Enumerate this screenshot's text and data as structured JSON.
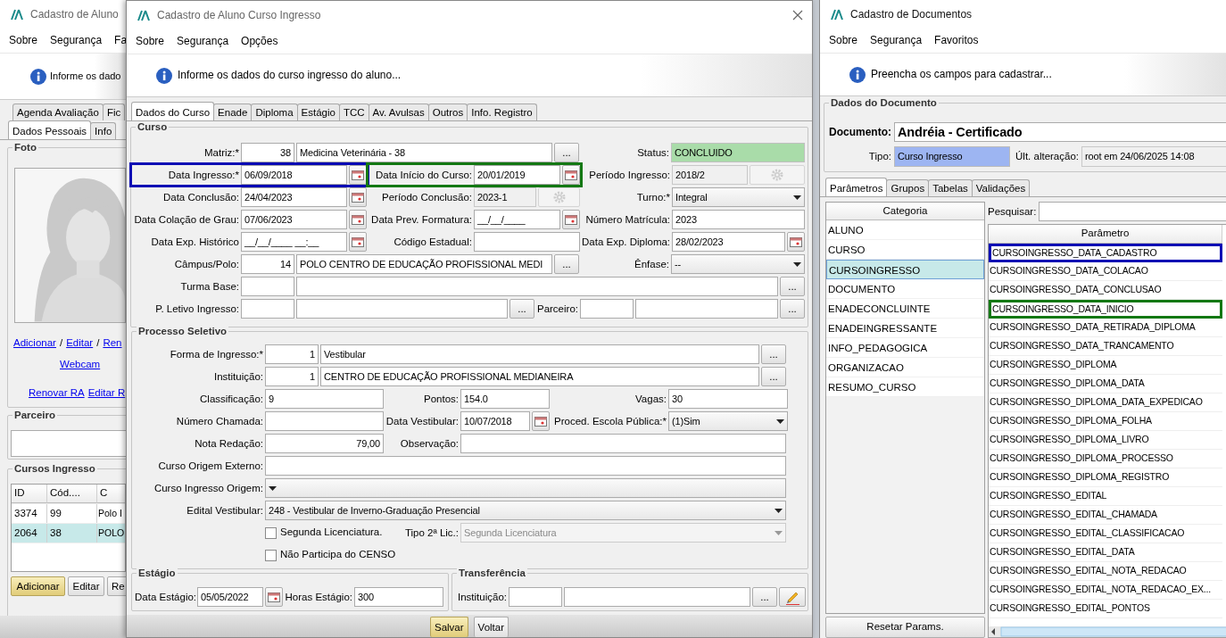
{
  "aluno_window": {
    "title": "Cadastro de Aluno",
    "menu": [
      "Sobre",
      "Segurança",
      "Fa"
    ],
    "info": "Informe os dado",
    "tab_rows": [
      {
        "tabs": [
          {
            "label": "Agenda Avaliação",
            "selected": false
          },
          {
            "label": "Fic",
            "selected": false
          }
        ]
      },
      {
        "tabs": [
          {
            "label": "Dados Pessoais",
            "selected": true
          },
          {
            "label": "Info",
            "selected": false
          }
        ]
      }
    ],
    "foto": {
      "title": "Foto",
      "link_rows": [
        {
          "items": [
            {
              "kind": "link",
              "text": "Adicionar"
            },
            {
              "kind": "sep",
              "text": "/"
            },
            {
              "kind": "link",
              "text": "Editar"
            },
            {
              "kind": "sep",
              "text": "/"
            },
            {
              "kind": "link",
              "text": "Ren"
            }
          ]
        },
        {
          "items": [
            {
              "kind": "link",
              "text": "Webcam"
            }
          ]
        },
        {
          "items": [
            {
              "kind": "link",
              "text": "Renovar RA"
            },
            {
              "kind": "link",
              "text": "Editar R"
            }
          ]
        }
      ]
    },
    "parceiro": {
      "title": "Parceiro"
    },
    "cursos": {
      "title": "Cursos Ingresso",
      "columns": [
        "ID",
        "Cód....",
        "C"
      ],
      "rows": [
        {
          "cells": [
            "3374",
            "99",
            "Polo I"
          ],
          "selected": false
        },
        {
          "cells": [
            "2064",
            "38",
            "POLO"
          ],
          "selected": true
        }
      ],
      "buttons": [
        {
          "label": "Adicionar",
          "default": true
        },
        {
          "label": "Editar",
          "default": false
        },
        {
          "label": "Re",
          "default": false
        }
      ]
    }
  },
  "curso_window": {
    "title": "Cadastro de Aluno Curso Ingresso",
    "menu": [
      "Sobre",
      "Segurança",
      "Opções"
    ],
    "info": "Informe os dados do curso ingresso do aluno...",
    "tabs": [
      {
        "label": "Dados do Curso",
        "selected": true
      },
      {
        "label": "Enade",
        "selected": false
      },
      {
        "label": "Diploma",
        "selected": false
      },
      {
        "label": "Estágio",
        "selected": false
      },
      {
        "label": "TCC",
        "selected": false
      },
      {
        "label": "Av. Avulsas",
        "selected": false
      },
      {
        "label": "Outros",
        "selected": false
      },
      {
        "label": "Info. Registro",
        "selected": false
      }
    ],
    "sections": [
      {
        "title": "Curso",
        "rows": [
          {
            "fields": [
              {
                "label": "Matriz:*",
                "kind": "lookup",
                "code": "38",
                "value": "Medicina Veterinária - 38",
                "button": "..."
              },
              {
                "label": "Status:",
                "kind": "status",
                "value": "CONCLUIDO"
              }
            ]
          },
          {
            "fields": [
              {
                "label": "Data Ingresso:*",
                "kind": "date",
                "value": "06/09/2018",
                "color": "#0a0ab4"
              },
              {
                "label": "Data Início do Curso:",
                "kind": "date",
                "value": "20/01/2019",
                "color": "#137813"
              },
              {
                "label": "Período Ingresso:",
                "kind": "readonly_gear",
                "value": "2018/2"
              }
            ]
          },
          {
            "fields": [
              {
                "label": "Data Conclusão:",
                "kind": "date",
                "value": "24/04/2023"
              },
              {
                "label": "Período Conclusão:",
                "kind": "readonly_gear",
                "value": "2023-1"
              },
              {
                "label": "Turno:*",
                "kind": "select",
                "value": "Integral"
              }
            ]
          },
          {
            "fields": [
              {
                "label": "Data Colação de Grau:",
                "kind": "date",
                "value": "07/06/2023"
              },
              {
                "label": "Data Prev. Formatura:",
                "kind": "date",
                "value": "__/__/____"
              },
              {
                "label": "Número Matrícula:",
                "kind": "text",
                "value": "2023"
              }
            ]
          },
          {
            "fields": [
              {
                "label": "Data Exp. Histórico",
                "kind": "date",
                "value": "__/__/____ __:__"
              },
              {
                "label": "Código Estadual:",
                "kind": "text"
              },
              {
                "label": "Data Exp. Diploma:",
                "kind": "date",
                "value": "28/02/2023"
              }
            ]
          },
          {
            "fields": [
              {
                "label": "Câmpus/Polo:",
                "kind": "lookup",
                "code": "14",
                "value": "POLO CENTRO DE EDUCAÇÃO PROFISSIONAL MEDI",
                "button": "..."
              },
              {
                "label": "Ênfase:",
                "kind": "select",
                "value": "--"
              }
            ]
          },
          {
            "fields": [
              {
                "label": "Turma Base:",
                "kind": "lookup",
                "button": "..."
              }
            ]
          },
          {
            "fields": [
              {
                "label": "P. Letivo Ingresso:",
                "kind": "lookup",
                "button": "..."
              },
              {
                "label": "Parceiro:",
                "kind": "lookup",
                "button": "..."
              }
            ]
          }
        ]
      },
      {
        "title": "Processo Seletivo",
        "rows": [
          {
            "fields": [
              {
                "label": "Forma de Ingresso:*",
                "kind": "lookup",
                "code": "1",
                "value": "Vestibular",
                "button": "..."
              }
            ]
          },
          {
            "fields": [
              {
                "label": "Instituição:",
                "kind": "lookup",
                "code": "1",
                "value": "CENTRO DE EDUCAÇÃO PROFISSIONAL MEDIANEIRA",
                "button": "..."
              }
            ]
          },
          {
            "fields": [
              {
                "label": "Classificação:",
                "kind": "text",
                "value": "9"
              },
              {
                "label": "Pontos:",
                "kind": "text",
                "value": "154.0"
              },
              {
                "label": "Vagas:",
                "kind": "text",
                "value": "30"
              }
            ]
          },
          {
            "fields": [
              {
                "label": "Número Chamada:",
                "kind": "text"
              },
              {
                "label": "Data Vestibular:",
                "kind": "date",
                "value": "10/07/2018"
              },
              {
                "label": "Proced. Escola Pública:*",
                "kind": "select",
                "value": "(1)Sim"
              }
            ]
          },
          {
            "fields": [
              {
                "label": "Nota Redação:",
                "kind": "number",
                "value": "79,00"
              },
              {
                "label": "Observação:",
                "kind": "text"
              }
            ]
          },
          {
            "fields": [
              {
                "label": "Curso Origem Externo:",
                "kind": "text"
              }
            ]
          },
          {
            "fields": [
              {
                "label": "Curso Ingresso Origem:",
                "kind": "select"
              }
            ]
          },
          {
            "fields": [
              {
                "label": "Edital Vestibular:",
                "kind": "select",
                "value": "248 - Vestibular de Inverno-Graduação Presencial"
              }
            ]
          },
          {
            "fields": [
              {
                "kind": "check",
                "text": "Segunda Licenciatura.",
                "checked": false
              },
              {
                "label": "Tipo 2ª Lic.:",
                "kind": "select_disabled",
                "value": "Segunda Licenciatura"
              }
            ]
          },
          {
            "fields": [
              {
                "kind": "check",
                "text": "Não Participa do CENSO",
                "checked": false
              }
            ]
          }
        ]
      },
      {
        "title": "Estágio",
        "rows": [
          {
            "fields": [
              {
                "label": "Data Estágio:",
                "kind": "date",
                "value": "05/05/2022"
              },
              {
                "label": "Horas Estágio:",
                "kind": "text",
                "value": "300"
              }
            ]
          }
        ]
      },
      {
        "title": "Transferência",
        "rows": [
          {
            "fields": [
              {
                "label": "Instituição:",
                "kind": "lookup_edit",
                "button": "..."
              }
            ]
          }
        ]
      }
    ],
    "buttons": [
      {
        "label": "Salvar",
        "default": true
      },
      {
        "label": "Voltar",
        "default": false
      }
    ]
  },
  "documentos_window": {
    "title": "Cadastro de Documentos",
    "menu": [
      "Sobre",
      "Segurança",
      "Favoritos"
    ],
    "info": "Preencha os campos para cadastrar...",
    "group_title": "Dados do Documento",
    "documento_label": "Documento:",
    "documento": "Andréia - Certificado",
    "tipo_label": "Tipo:",
    "tipo": "Curso Ingresso",
    "alteracao_label": "Últ. alteração:",
    "alteracao": "root em 24/06/2025 14:08",
    "tabs": [
      {
        "label": "Parâmetros",
        "selected": true
      },
      {
        "label": "Grupos",
        "selected": false
      },
      {
        "label": "Tabelas",
        "selected": false
      },
      {
        "label": "Validações",
        "selected": false
      }
    ],
    "categoria": {
      "header": "Categoria",
      "items": [
        {
          "label": "ALUNO",
          "selected": false
        },
        {
          "label": "CURSO",
          "selected": false
        },
        {
          "label": "CURSOINGRESSO",
          "selected": true
        },
        {
          "label": "DOCUMENTO",
          "selected": false
        },
        {
          "label": "ENADECONCLUINTE",
          "selected": false
        },
        {
          "label": "ENADEINGRESSANTE",
          "selected": false
        },
        {
          "label": "INFO_PEDAGOGICA",
          "selected": false
        },
        {
          "label": "ORGANIZACAO",
          "selected": false
        },
        {
          "label": "RESUMO_CURSO",
          "selected": false
        }
      ]
    },
    "search_label": "Pesquisar:",
    "parametro": {
      "header": "Parâmetro",
      "rows": [
        {
          "label": "CURSOINGRESSO_DATA_CADASTRO",
          "color": "#0a0ab4"
        },
        {
          "label": "CURSOINGRESSO_DATA_COLACAO"
        },
        {
          "label": "CURSOINGRESSO_DATA_CONCLUSAO"
        },
        {
          "label": "CURSOINGRESSO_DATA_INICIO",
          "color": "#137813"
        },
        {
          "label": "CURSOINGRESSO_DATA_RETIRADA_DIPLOMA"
        },
        {
          "label": "CURSOINGRESSO_DATA_TRANCAMENTO"
        },
        {
          "label": "CURSOINGRESSO_DIPLOMA"
        },
        {
          "label": "CURSOINGRESSO_DIPLOMA_DATA"
        },
        {
          "label": "CURSOINGRESSO_DIPLOMA_DATA_EXPEDICAO"
        },
        {
          "label": "CURSOINGRESSO_DIPLOMA_FOLHA"
        },
        {
          "label": "CURSOINGRESSO_DIPLOMA_LIVRO"
        },
        {
          "label": "CURSOINGRESSO_DIPLOMA_PROCESSO"
        },
        {
          "label": "CURSOINGRESSO_DIPLOMA_REGISTRO"
        },
        {
          "label": "CURSOINGRESSO_EDITAL"
        },
        {
          "label": "CURSOINGRESSO_EDITAL_CHAMADA"
        },
        {
          "label": "CURSOINGRESSO_EDITAL_CLASSIFICACAO"
        },
        {
          "label": "CURSOINGRESSO_EDITAL_DATA"
        },
        {
          "label": "CURSOINGRESSO_EDITAL_NOTA_REDACAO"
        },
        {
          "label": "CURSOINGRESSO_EDITAL_NOTA_REDACAO_EX..."
        },
        {
          "label": "CURSOINGRESSO_EDITAL_PONTOS"
        }
      ]
    },
    "reset_button": "Resetar Params."
  }
}
